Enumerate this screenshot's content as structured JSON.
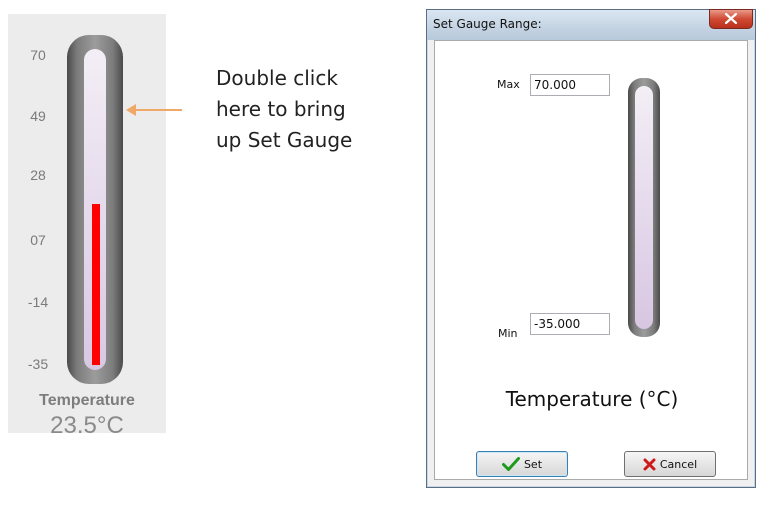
{
  "gauge": {
    "ticks": [
      "70",
      "49",
      "28",
      "07",
      "-14",
      "-35"
    ],
    "title": "Temperature",
    "value": "23.5°C",
    "level_celsius": 23.5,
    "range_min": -35,
    "range_max": 70,
    "fill_color": "#ff0000"
  },
  "annotation": {
    "lines": [
      "Double click",
      "here to bring",
      "up Set Gauge"
    ],
    "arrow_color": "#f0a868"
  },
  "dialog": {
    "title": "Set Gauge Range:",
    "max_label": "Max",
    "max_value": "70.000",
    "min_label": "Min",
    "min_value": "-35.000",
    "gauge_title": "Temperature (°C)",
    "set_label": "Set",
    "cancel_label": "Cancel",
    "icons": {
      "close": "close-icon",
      "set": "checkmark-icon",
      "cancel": "x-icon"
    }
  }
}
